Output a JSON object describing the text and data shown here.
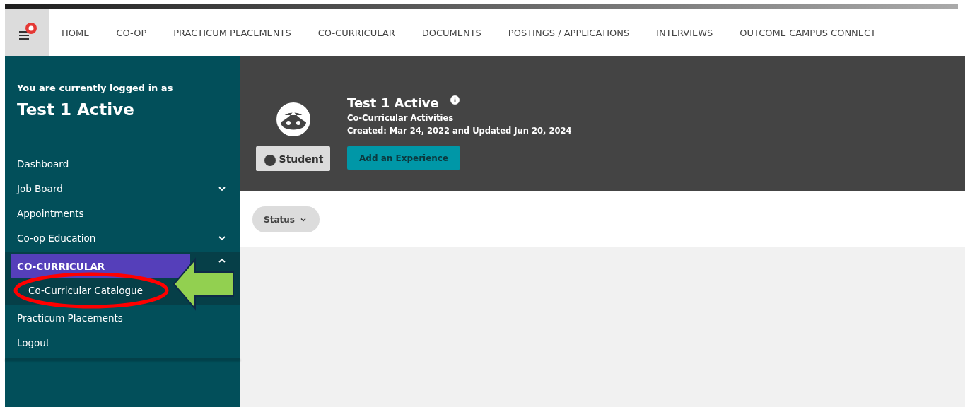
{
  "top_nav": {
    "items": [
      "HOME",
      "CO-OP",
      "PRACTICUM PLACEMENTS",
      "CO-CURRICULAR",
      "DOCUMENTS",
      "POSTINGS / APPLICATIONS",
      "INTERVIEWS",
      "OUTCOME CAMPUS CONNECT"
    ]
  },
  "sidebar": {
    "intro": "You are currently logged in as",
    "user_name": "Test 1 Active",
    "items": [
      {
        "label": "Dashboard",
        "selected": false
      },
      {
        "label": "Job Board",
        "selected": false,
        "expanded": false
      },
      {
        "label": "Appointments",
        "selected": false
      },
      {
        "label": "Co-op Education",
        "selected": false,
        "expanded": false
      },
      {
        "label": "CO-CURRICULAR",
        "selected": true,
        "expanded": true,
        "children": [
          {
            "label": "Co-Curricular Catalogue",
            "selected": false
          }
        ]
      },
      {
        "label": "Practicum Placements",
        "selected": false
      },
      {
        "label": "Logout",
        "selected": false
      }
    ]
  },
  "profile": {
    "title": "Test 1 Active",
    "subtitle": "Co-Curricular Activities",
    "dates": "Created: Mar 24, 2022 and Updated Jun 20, 2024",
    "role_badge": "Student",
    "action_button": "Add an Experience"
  },
  "filters": [
    {
      "label": "Status"
    }
  ]
}
